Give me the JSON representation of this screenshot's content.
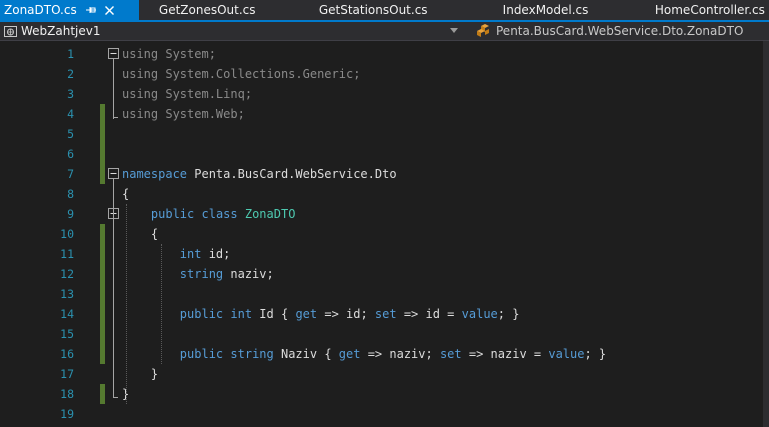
{
  "tabs": [
    {
      "label": "ZonaDTO.cs",
      "active": true
    },
    {
      "label": "GetZonesOut.cs",
      "active": false
    },
    {
      "label": "GetStationsOut.cs",
      "active": false
    },
    {
      "label": "IndexModel.cs",
      "active": false
    },
    {
      "label": "HomeController.cs",
      "active": false
    }
  ],
  "navbar": {
    "project": "WebZahtjev1",
    "namespace": "Penta.BusCard.WebService.Dto.ZonaDTO"
  },
  "editor": {
    "lines": [
      {
        "num": "1",
        "tokens": [
          {
            "t": "using",
            "c": "kw"
          },
          {
            "t": " System;",
            "c": "pl"
          }
        ],
        "fold": "minus",
        "changed": false
      },
      {
        "num": "2",
        "tokens": [
          {
            "t": "using",
            "c": "kw"
          },
          {
            "t": " System.Collections.Generic;",
            "c": "pl"
          }
        ],
        "fold": "",
        "changed": false
      },
      {
        "num": "3",
        "tokens": [
          {
            "t": "using",
            "c": "kw"
          },
          {
            "t": " System.Linq;",
            "c": "pl"
          }
        ],
        "fold": "",
        "changed": false
      },
      {
        "num": "4",
        "tokens": [
          {
            "t": "using",
            "c": "kw"
          },
          {
            "t": " System.Web;",
            "c": "pl"
          }
        ],
        "fold": "",
        "changed": true
      },
      {
        "num": "5",
        "tokens": [],
        "fold": "",
        "changed": true
      },
      {
        "num": "6",
        "tokens": [],
        "fold": "",
        "changed": true
      },
      {
        "num": "7",
        "tokens": [
          {
            "t": "namespace",
            "c": "kw"
          },
          {
            "t": " Penta.BusCard.WebService.Dto",
            "c": "pl"
          }
        ],
        "fold": "minus",
        "changed": true
      },
      {
        "num": "8",
        "tokens": [
          {
            "t": "{",
            "c": "pl"
          }
        ],
        "fold": "",
        "changed": false
      },
      {
        "num": "9",
        "tokens": [
          {
            "t": "    ",
            "c": "pl"
          },
          {
            "t": "public",
            "c": "kw"
          },
          {
            "t": " ",
            "c": "pl"
          },
          {
            "t": "class",
            "c": "kw"
          },
          {
            "t": " ",
            "c": "pl"
          },
          {
            "t": "ZonaDTO",
            "c": "ty"
          }
        ],
        "fold": "minus",
        "changed": false
      },
      {
        "num": "10",
        "tokens": [
          {
            "t": "    {",
            "c": "pl"
          }
        ],
        "fold": "",
        "changed": true
      },
      {
        "num": "11",
        "tokens": [
          {
            "t": "        ",
            "c": "pl"
          },
          {
            "t": "int",
            "c": "kw"
          },
          {
            "t": " id;",
            "c": "pl"
          }
        ],
        "fold": "",
        "changed": true
      },
      {
        "num": "12",
        "tokens": [
          {
            "t": "        ",
            "c": "pl"
          },
          {
            "t": "string",
            "c": "kw"
          },
          {
            "t": " naziv;",
            "c": "pl"
          }
        ],
        "fold": "",
        "changed": true
      },
      {
        "num": "13",
        "tokens": [],
        "fold": "",
        "changed": true
      },
      {
        "num": "14",
        "tokens": [
          {
            "t": "        ",
            "c": "pl"
          },
          {
            "t": "public",
            "c": "kw"
          },
          {
            "t": " ",
            "c": "pl"
          },
          {
            "t": "int",
            "c": "kw"
          },
          {
            "t": " Id { ",
            "c": "pl"
          },
          {
            "t": "get",
            "c": "kw"
          },
          {
            "t": " => id; ",
            "c": "pl"
          },
          {
            "t": "set",
            "c": "kw"
          },
          {
            "t": " => id = ",
            "c": "pl"
          },
          {
            "t": "value",
            "c": "kw"
          },
          {
            "t": "; }",
            "c": "pl"
          }
        ],
        "fold": "",
        "changed": true
      },
      {
        "num": "15",
        "tokens": [],
        "fold": "",
        "changed": true
      },
      {
        "num": "16",
        "tokens": [
          {
            "t": "        ",
            "c": "pl"
          },
          {
            "t": "public",
            "c": "kw"
          },
          {
            "t": " ",
            "c": "pl"
          },
          {
            "t": "string",
            "c": "kw"
          },
          {
            "t": " Naziv { ",
            "c": "pl"
          },
          {
            "t": "get",
            "c": "kw"
          },
          {
            "t": " => naziv; ",
            "c": "pl"
          },
          {
            "t": "set",
            "c": "kw"
          },
          {
            "t": " => naziv = ",
            "c": "pl"
          },
          {
            "t": "value",
            "c": "kw"
          },
          {
            "t": "; }",
            "c": "pl"
          }
        ],
        "fold": "",
        "changed": true
      },
      {
        "num": "17",
        "tokens": [
          {
            "t": "    }",
            "c": "pl"
          }
        ],
        "fold": "",
        "changed": false
      },
      {
        "num": "18",
        "tokens": [
          {
            "t": "}",
            "c": "pl"
          }
        ],
        "fold": "",
        "changed": true
      },
      {
        "num": "19",
        "tokens": [],
        "fold": "",
        "changed": false
      }
    ]
  },
  "colors": {
    "keyword": "#569cd6",
    "type": "#4ec9b0",
    "plain": "#dcdcdc",
    "line_number": "#2b91af",
    "active_tab": "#007acc",
    "change_bar": "#557a30",
    "using_dim": "#8a8a8a"
  },
  "icons": {
    "pin": "pin-icon",
    "close": "close-icon",
    "project": "project-icon",
    "namespace": "class-icon",
    "fold": "collapse-icon"
  }
}
